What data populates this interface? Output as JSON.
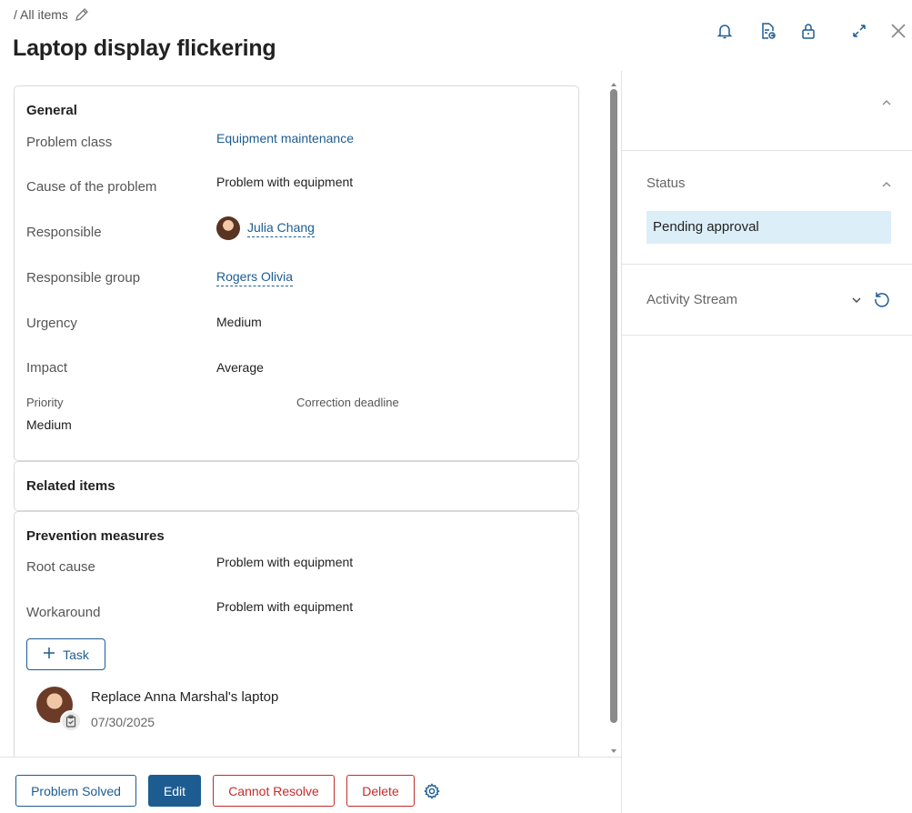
{
  "header": {
    "breadcrumb": "/ All items",
    "title": "Laptop display flickering"
  },
  "general": {
    "title": "General",
    "fields": [
      {
        "label": "Problem class",
        "value": "Equipment maintenance"
      },
      {
        "label": "Cause of the problem",
        "value": "Problem with equipment"
      },
      {
        "label": "Responsible",
        "value": "Julia Chang"
      },
      {
        "label": "Responsible group",
        "value": "Rogers Olivia"
      },
      {
        "label": "Urgency",
        "value": "Medium"
      },
      {
        "label": "Impact",
        "value": "Average"
      }
    ],
    "priority_label": "Priority",
    "priority_value": "Medium",
    "deadline_label": "Correction deadline"
  },
  "related": {
    "title": "Related items"
  },
  "prevention": {
    "title": "Prevention measures",
    "fields": [
      {
        "label": "Root cause",
        "value": "Problem with equipment"
      },
      {
        "label": "Workaround",
        "value": "Problem with equipment"
      }
    ],
    "task_button": "Task",
    "task": {
      "title": "Replace Anna Marshal's laptop",
      "date": "07/30/2025"
    }
  },
  "right_panel": {
    "status_label": "Status",
    "status_value": "Pending approval",
    "activity_label": "Activity Stream"
  },
  "footer": {
    "problem_solved": "Problem Solved",
    "edit": "Edit",
    "cannot_resolve": "Cannot Resolve",
    "delete": "Delete"
  },
  "colors": {
    "accent": "#1d5c91",
    "danger": "#c62b2b",
    "status_bg": "#dceef8"
  }
}
